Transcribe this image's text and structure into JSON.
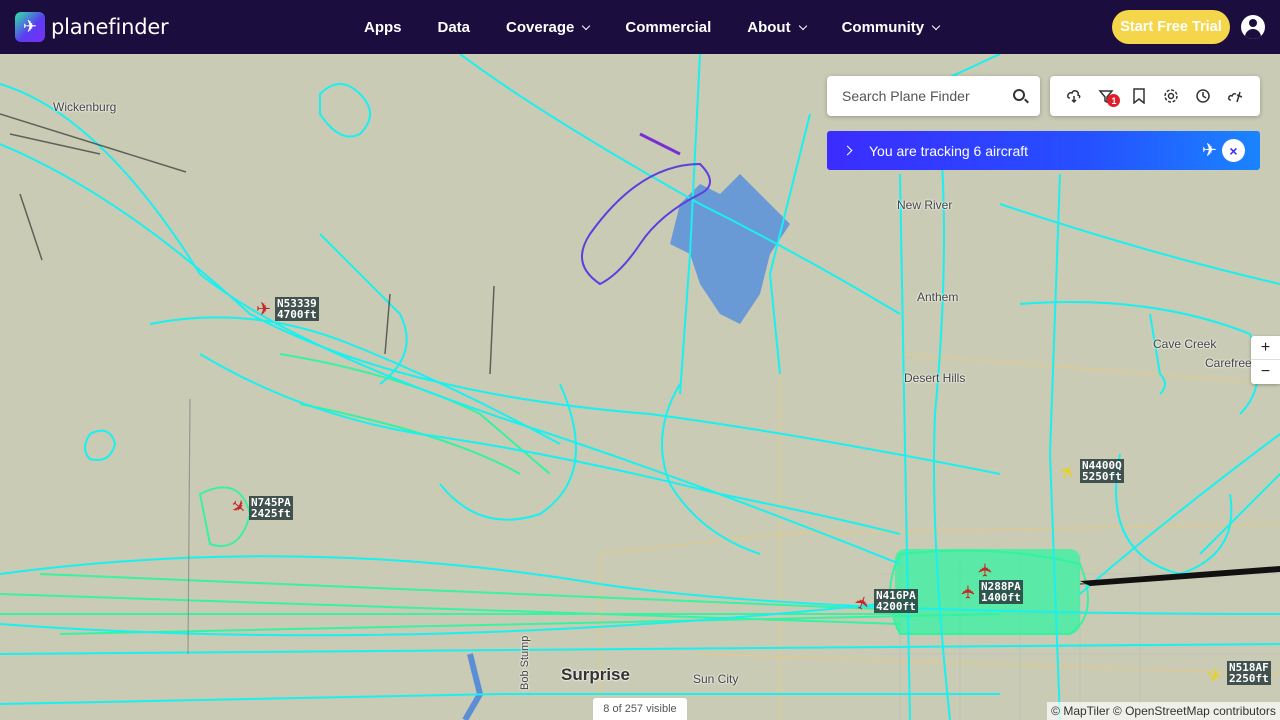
{
  "header": {
    "brand": "planefinder",
    "nav": [
      {
        "label": "Apps",
        "has_dropdown": false
      },
      {
        "label": "Data",
        "has_dropdown": false
      },
      {
        "label": "Coverage",
        "has_dropdown": true
      },
      {
        "label": "Commercial",
        "has_dropdown": false
      },
      {
        "label": "About",
        "has_dropdown": true
      },
      {
        "label": "Community",
        "has_dropdown": true
      }
    ],
    "trial_label": "Start Free Trial"
  },
  "search": {
    "placeholder": "Search Plane Finder"
  },
  "toolbar": {
    "filter_badge": "1"
  },
  "tracking": {
    "text": "You are tracking 6 aircraft",
    "close_symbol": "×"
  },
  "zoom": {
    "in": "+",
    "out": "−"
  },
  "map": {
    "towns": [
      {
        "name": "Wickenburg"
      },
      {
        "name": "New River"
      },
      {
        "name": "Anthem"
      },
      {
        "name": "Desert Hills"
      },
      {
        "name": "Cave Creek"
      },
      {
        "name": "Carefree"
      },
      {
        "name": "Surprise"
      },
      {
        "name": "Sun City"
      },
      {
        "name": "Bob Stump"
      }
    ],
    "aircraft": [
      {
        "callsign": "N53339",
        "altitude": "4700ft"
      },
      {
        "callsign": "N745PA",
        "altitude": "2425ft"
      },
      {
        "callsign": "N4400Q",
        "altitude": "5250ft"
      },
      {
        "callsign": "N416PA",
        "altitude": "4200ft"
      },
      {
        "callsign": "N288PA",
        "altitude": "1400ft"
      },
      {
        "callsign": "N518AF",
        "altitude": "2250ft"
      }
    ],
    "colors": {
      "track_cyan": "#19f0f0",
      "track_green": "#2bf5a0",
      "track_blue": "#1e88e5",
      "lake": "#6a9ad6"
    }
  },
  "footer": {
    "visible_count": "8 of 257 visible",
    "attribution": "© MapTiler © OpenStreetMap contributors"
  }
}
